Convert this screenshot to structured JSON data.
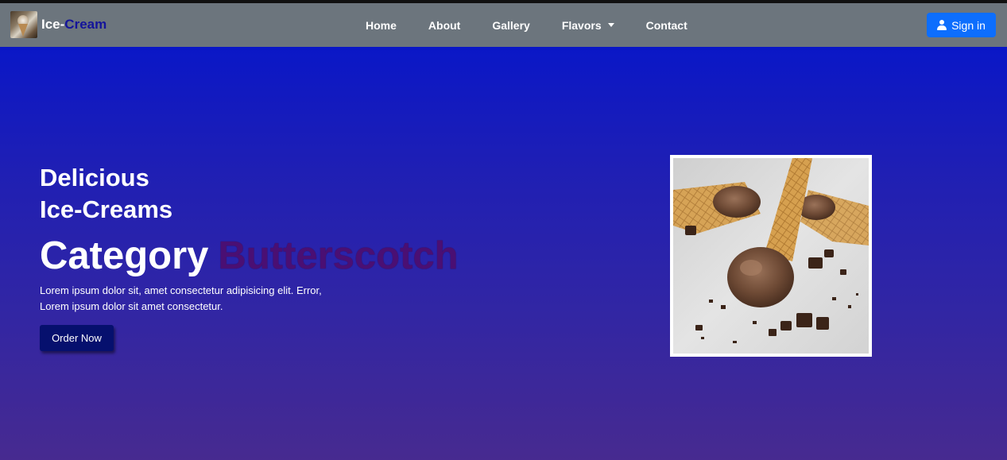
{
  "navbar": {
    "brand_part1": "Ice-",
    "brand_part2": "Cream",
    "links": [
      {
        "label": "Home"
      },
      {
        "label": "About"
      },
      {
        "label": "Gallery"
      },
      {
        "label": "Flavors"
      },
      {
        "label": "Contact"
      }
    ],
    "signin_label": "Sign in"
  },
  "hero": {
    "heading_line1": "Delicious",
    "heading_line2": "Ice-Creams",
    "category_word": "Category",
    "category_flavor": "Butterscotch",
    "description": "Lorem ipsum dolor sit, amet consectetur adipisicing elit. Error, Lorem ipsum dolor sit amet consectetur.",
    "order_button": "Order Now"
  },
  "colors": {
    "navbar_bg": "#6c757d",
    "signin_bg": "#0d6efd",
    "hero_top": "#0a17c7",
    "hero_bottom": "#472a90",
    "flavor_text": "#4a0f73",
    "order_bg": "#06106e"
  },
  "icons": {
    "signin": "person-icon",
    "flavors_dropdown": "caret-down-icon"
  }
}
